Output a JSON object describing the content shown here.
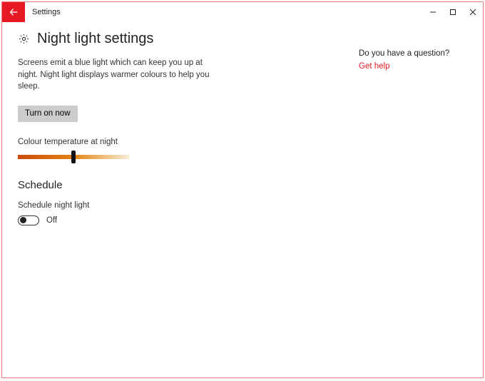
{
  "titlebar": {
    "app": "Settings"
  },
  "page": {
    "title": "Night light settings",
    "description": "Screens emit a blue light which can keep you up at night. Night light displays warmer colours to help you sleep.",
    "turn_on_label": "Turn on now",
    "slider_label": "Colour temperature at night",
    "slider_position_pct": 50,
    "schedule_heading": "Schedule",
    "schedule_toggle_label": "Schedule night light",
    "schedule_toggle_value": "Off"
  },
  "help": {
    "question": "Do you have a question?",
    "link": "Get help"
  }
}
